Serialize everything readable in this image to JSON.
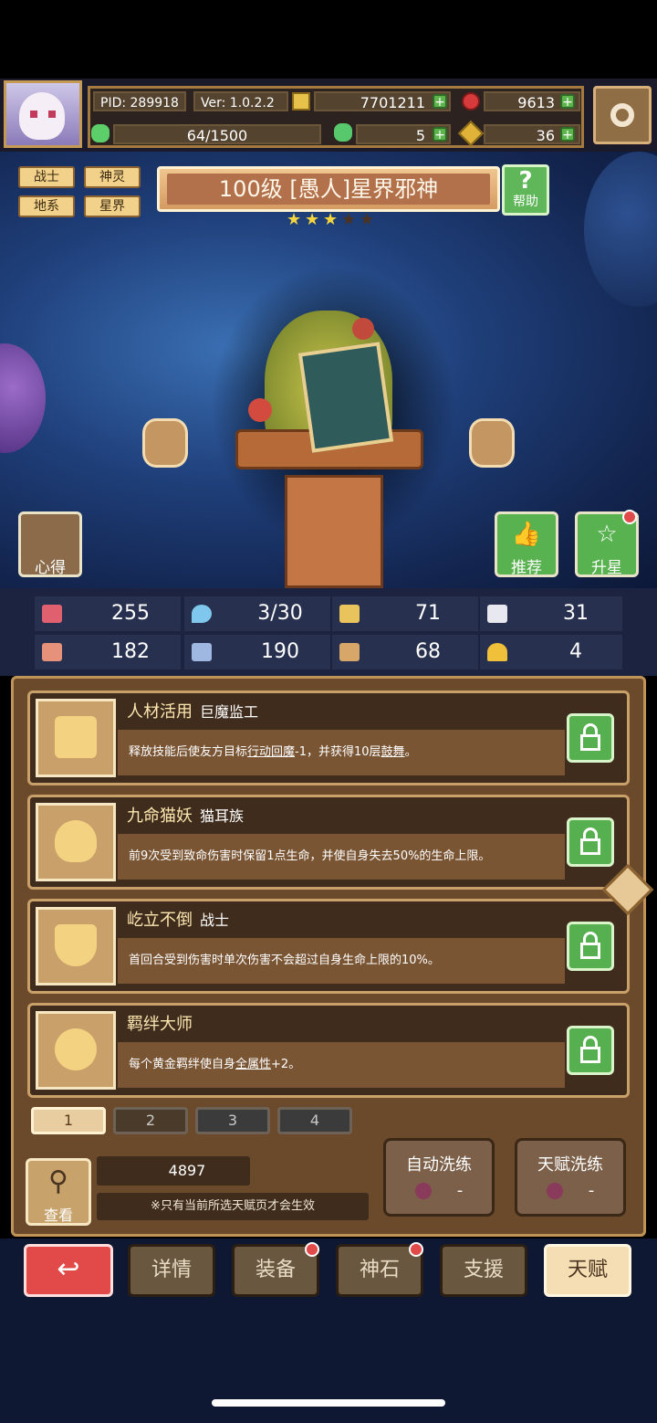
{
  "header": {
    "pid": "PID: 289918",
    "version": "Ver: 1.0.2.2",
    "gold": "7701211",
    "ruby": "9613",
    "exp": "64/1500",
    "clover": "5",
    "key": "36"
  },
  "tags": [
    "战士",
    "神灵",
    "地系",
    "星界"
  ],
  "hero": {
    "title": "100级 [愚人]星界邪神",
    "stars_filled": 3,
    "stars_total": 5,
    "help_label": "帮助"
  },
  "side_buttons": {
    "notes": "心得",
    "recommend": "推荐",
    "star_up": "升星"
  },
  "stats": [
    {
      "icon": "heart-icon",
      "value": "255",
      "color": "#e06070"
    },
    {
      "icon": "water-drop-icon",
      "value": "3/30",
      "color": "#7fc7ec"
    },
    {
      "icon": "shield-icon",
      "value": "71",
      "color": "#e9c35b"
    },
    {
      "icon": "wing-icon",
      "value": "31",
      "color": "#e8e8f0"
    },
    {
      "icon": "fist-icon",
      "value": "182",
      "color": "#e6927a"
    },
    {
      "icon": "book-icon",
      "value": "190",
      "color": "#9fb8e2"
    },
    {
      "icon": "scroll-icon",
      "value": "68",
      "color": "#d7a76a"
    },
    {
      "icon": "horseshoe-icon",
      "value": "4",
      "color": "#f0c03a"
    }
  ],
  "talents": [
    {
      "name": "人材活用",
      "tag": "巨魔监工",
      "desc_a": "释放技能后使友方目标",
      "desc_u1": "行动回魔",
      "desc_b": "-1，并获得10层",
      "desc_u2": "鼓舞",
      "desc_c": "。"
    },
    {
      "name": "九命猫妖",
      "tag": "猫耳族",
      "desc_a": "前9次受到致命伤害时保留1点生命，并使自身失去50%的生命上限。",
      "desc_u1": "",
      "desc_b": "",
      "desc_u2": "",
      "desc_c": ""
    },
    {
      "name": "屹立不倒",
      "tag": "战士",
      "desc_a": "首回合受到伤害时单次伤害不会超过自身生命上限的10%。",
      "desc_u1": "",
      "desc_b": "",
      "desc_u2": "",
      "desc_c": ""
    },
    {
      "name": "羁绊大师",
      "tag": "",
      "desc_a": "每个黄金羁绊使自身",
      "desc_u1": "全属性",
      "desc_b": "+2。",
      "desc_u2": "",
      "desc_c": ""
    }
  ],
  "pages": [
    "1",
    "2",
    "3",
    "4"
  ],
  "lower": {
    "view_label": "查看",
    "fruit_count": "4897",
    "note": "※只有当前所选天赋页才会生效",
    "auto_refine": "自动洗练",
    "talent_refine": "天赋洗练",
    "auto_cost": "-",
    "talent_cost": "-"
  },
  "nav": [
    "详情",
    "装备",
    "神石",
    "支援",
    "天赋"
  ]
}
